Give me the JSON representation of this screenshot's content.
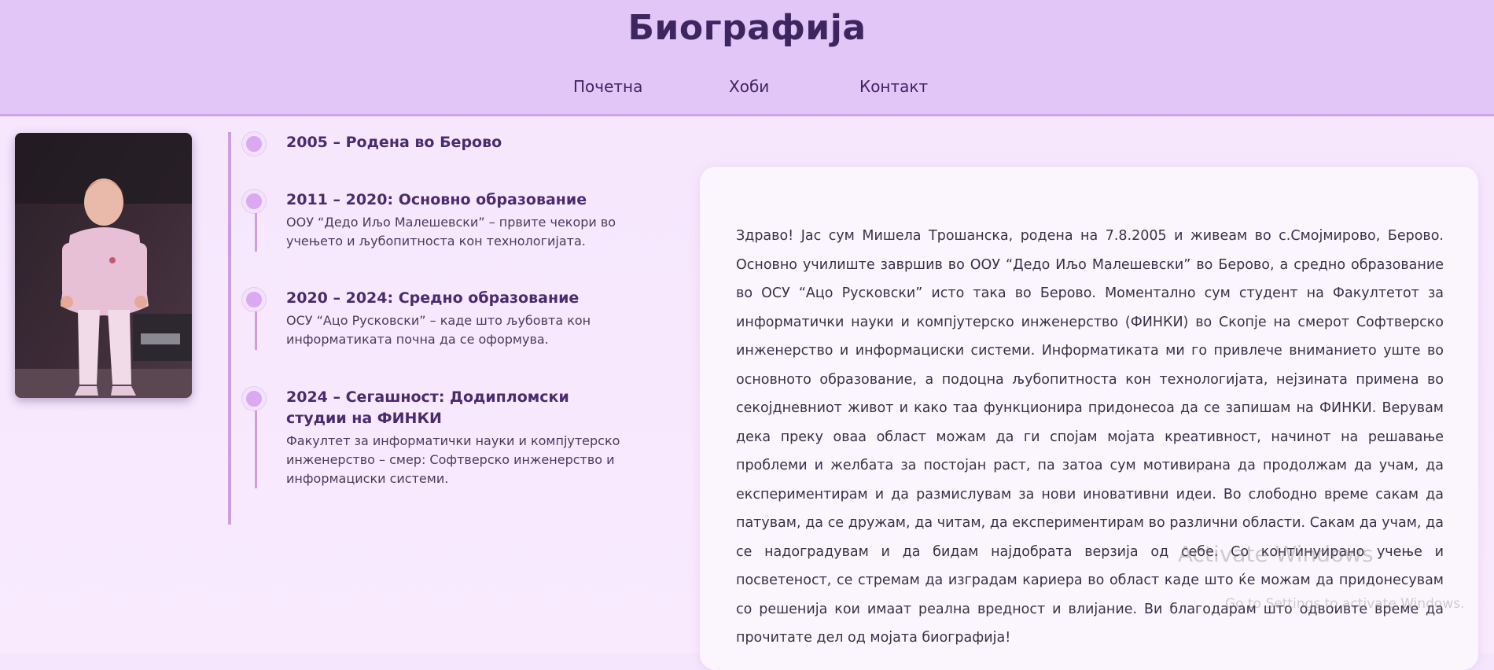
{
  "header": {
    "title": "Биографија",
    "nav": [
      {
        "label": "Почетна"
      },
      {
        "label": "Хоби"
      },
      {
        "label": "Контакт"
      }
    ]
  },
  "timeline": [
    {
      "title": "2005 – Родена во Берово",
      "desc": ""
    },
    {
      "title": "2011 – 2020: Основно образование",
      "desc": "ООУ “Дедо Иљо Малешевски” – првите чекори во учењето и љубопитноста кон технологијата."
    },
    {
      "title": "2020 – 2024: Средно образование",
      "desc": "ОСУ “Ацо Русковски” – каде што љубовта кон информатиката почна да се оформува."
    },
    {
      "title": "2024 – Сегашност: Додипломски студии на ФИНКИ",
      "desc": "Факултет за информатички науки и компјутерско инженерство – смер: Софтверско инженерство и информациски системи."
    }
  ],
  "bio": "Здраво! Јас сум Мишела Трошанска, родена на 7.8.2005 и живеам во с.Смојмирово, Берово. Основно училиште завршив во ООУ “Дедо Иљо Малешевски” во Берово, а средно образование во ОСУ “Ацо Русковски” исто така во Берово. Моментално сум студент на Факултетот за информатички науки и компјутерско инженерство (ФИНКИ) во Скопје на смерот Софтверско инженерство и информациски системи. Информатиката ми го привлече вниманието уште во основното образование, а подоцна љубопитноста кон технологијата, нејзината примена во секојдневниот живот и како таа функционира придонесоа да се запишам на ФИНКИ. Верувам дека преку оваа област можам да ги спојам мојата креативност, начинот на решавање проблеми и желбата за постојан раст, па затоа сум мотивирана да продолжам да учам, да експериментирам и да размислувам за нови иновативни идеи. Во слободно време сакам да патувам, да се дружам, да читам, да експериментирам во различни области. Сакам да учам, да се надоградувам и да бидам најдобрата верзија од себе. Со континуирано учење и посветеност, се стремам да изградам кариера во област каде што ќе можам да придонесувам со решенија кои имаат реална вредност и влијание. Ви благодарам што одвоивте време да прочитате дел од мојата биографија!",
  "watermark": {
    "title": "Activate Windows",
    "subtitle": "Go to Settings to activate Windows."
  },
  "colors": {
    "header_bg": "#e3c6f8",
    "accent": "#cc9fe0",
    "title": "#3d2560",
    "card_bg": "#fbf6fe"
  }
}
